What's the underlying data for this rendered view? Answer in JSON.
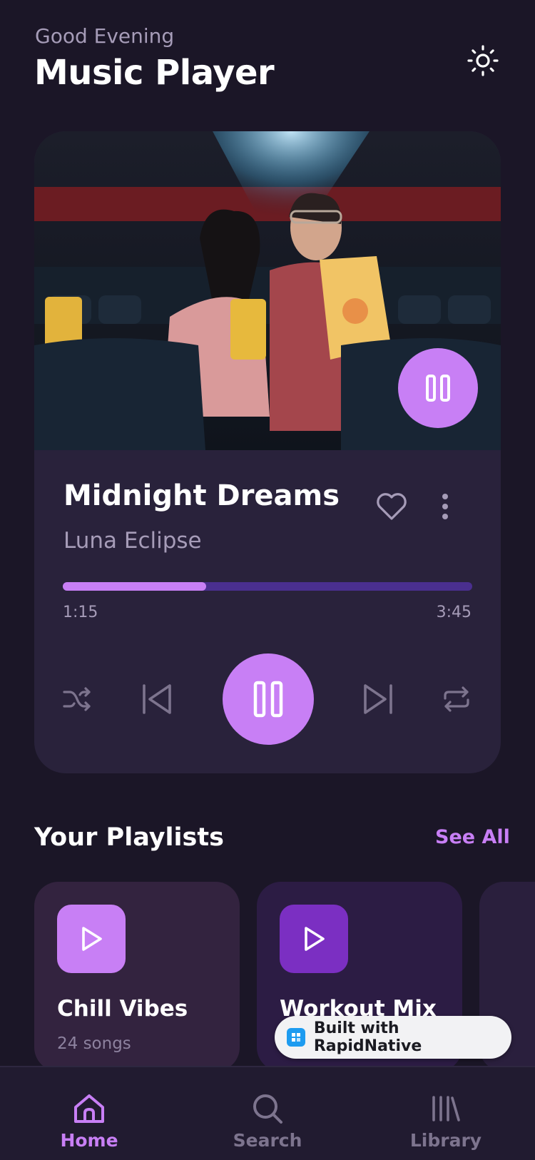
{
  "header": {
    "greeting": "Good Evening",
    "title": "Music Player",
    "theme_icon": "sun-icon"
  },
  "now_playing": {
    "song_title": "Midnight Dreams",
    "artist": "Luna Eclipse",
    "progress_fraction": 0.35,
    "current_time": "1:15",
    "total_time": "3:45",
    "is_playing": true
  },
  "controls": {
    "shuffle_icon": "shuffle-icon",
    "previous_icon": "skip-back-icon",
    "play_pause_icon": "pause-icon",
    "next_icon": "skip-forward-icon",
    "repeat_icon": "repeat-icon"
  },
  "playlists": {
    "heading": "Your Playlists",
    "see_all": "See All",
    "items": [
      {
        "name": "Chill Vibes",
        "count": "24 songs"
      },
      {
        "name": "Workout Mix",
        "count": ""
      }
    ]
  },
  "badge": {
    "label": "Built with RapidNative"
  },
  "nav": {
    "items": [
      {
        "label": "Home",
        "active": true
      },
      {
        "label": "Search",
        "active": false
      },
      {
        "label": "Library",
        "active": false
      }
    ]
  },
  "colors": {
    "background": "#1b1627",
    "card": "#29223b",
    "accent": "#c87ff5",
    "accent_dark": "#7b2fc2",
    "progress_track": "#4a2f8f",
    "muted_text": "#a69cb8"
  }
}
